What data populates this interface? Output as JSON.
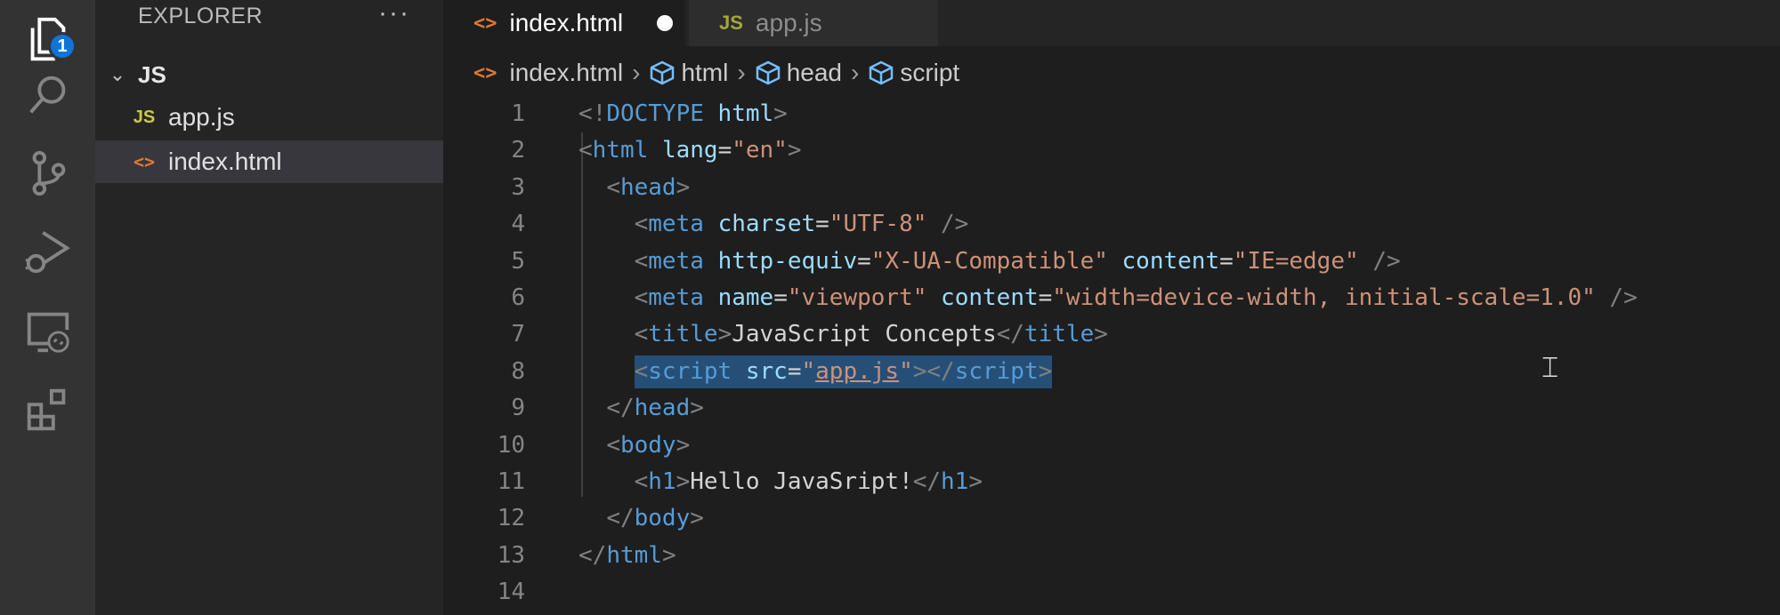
{
  "activity_bar": {
    "explorer_badge": "1",
    "icons": [
      "files-icon",
      "search-icon",
      "source-control-icon",
      "run-debug-icon",
      "remote-explorer-icon",
      "extensions-icon"
    ]
  },
  "sidebar": {
    "title": "EXPLORER",
    "more": "···",
    "folder": "JS",
    "files": [
      {
        "icon_text": "JS",
        "name": "app.js",
        "selected": false
      },
      {
        "icon_text": "<>",
        "name": "index.html",
        "selected": true
      }
    ]
  },
  "tabs": [
    {
      "icon_text": "<>",
      "label": "index.html",
      "active": true,
      "dirty": true
    },
    {
      "icon_text": "JS",
      "label": "app.js",
      "active": false,
      "dirty": false
    }
  ],
  "breadcrumb": {
    "file": "index.html",
    "items": [
      "html",
      "head",
      "script"
    ]
  },
  "code": {
    "lines": [
      {
        "n": "1",
        "tokens": [
          [
            "t",
            "<!"
          ],
          [
            "tg",
            "DOCTYPE"
          ],
          [
            "tx",
            " "
          ],
          [
            "at",
            "html"
          ],
          [
            "t",
            ">"
          ]
        ]
      },
      {
        "n": "2",
        "tokens": [
          [
            "t",
            "<"
          ],
          [
            "tg",
            "html"
          ],
          [
            "tx",
            " "
          ],
          [
            "at",
            "lang"
          ],
          [
            "tx",
            "="
          ],
          [
            "st",
            "\"en\""
          ],
          [
            "t",
            ">"
          ]
        ]
      },
      {
        "n": "3",
        "tokens": [
          [
            "tx",
            "  "
          ],
          [
            "t",
            "<"
          ],
          [
            "tg",
            "head"
          ],
          [
            "t",
            ">"
          ]
        ]
      },
      {
        "n": "4",
        "tokens": [
          [
            "tx",
            "    "
          ],
          [
            "t",
            "<"
          ],
          [
            "tg",
            "meta"
          ],
          [
            "tx",
            " "
          ],
          [
            "at",
            "charset"
          ],
          [
            "tx",
            "="
          ],
          [
            "st",
            "\"UTF-8\""
          ],
          [
            "tx",
            " "
          ],
          [
            "t",
            "/>"
          ]
        ]
      },
      {
        "n": "5",
        "tokens": [
          [
            "tx",
            "    "
          ],
          [
            "t",
            "<"
          ],
          [
            "tg",
            "meta"
          ],
          [
            "tx",
            " "
          ],
          [
            "at",
            "http-equiv"
          ],
          [
            "tx",
            "="
          ],
          [
            "st",
            "\"X-UA-Compatible\""
          ],
          [
            "tx",
            " "
          ],
          [
            "at",
            "content"
          ],
          [
            "tx",
            "="
          ],
          [
            "st",
            "\"IE=edge\""
          ],
          [
            "tx",
            " "
          ],
          [
            "t",
            "/>"
          ]
        ]
      },
      {
        "n": "6",
        "tokens": [
          [
            "tx",
            "    "
          ],
          [
            "t",
            "<"
          ],
          [
            "tg",
            "meta"
          ],
          [
            "tx",
            " "
          ],
          [
            "at",
            "name"
          ],
          [
            "tx",
            "="
          ],
          [
            "st",
            "\"viewport\""
          ],
          [
            "tx",
            " "
          ],
          [
            "at",
            "content"
          ],
          [
            "tx",
            "="
          ],
          [
            "st",
            "\"width=device-width, initial-scale=1.0\""
          ],
          [
            "tx",
            " "
          ],
          [
            "t",
            "/>"
          ]
        ]
      },
      {
        "n": "7",
        "tokens": [
          [
            "tx",
            "    "
          ],
          [
            "t",
            "<"
          ],
          [
            "tg",
            "title"
          ],
          [
            "t",
            ">"
          ],
          [
            "tx",
            "JavaScript Concepts"
          ],
          [
            "t",
            "</"
          ],
          [
            "tg",
            "title"
          ],
          [
            "t",
            ">"
          ]
        ]
      },
      {
        "n": "8",
        "tokens": [
          [
            "tx",
            "    "
          ],
          [
            "t",
            "<"
          ],
          [
            "tg",
            "script"
          ],
          [
            "tx",
            " "
          ],
          [
            "at",
            "src"
          ],
          [
            "tx",
            "="
          ],
          [
            "st",
            "\""
          ],
          [
            "stu",
            "app.js"
          ],
          [
            "st",
            "\""
          ],
          [
            "t",
            "></"
          ],
          [
            "tg",
            "script"
          ],
          [
            "t",
            ">"
          ]
        ],
        "selected": true
      },
      {
        "n": "9",
        "tokens": [
          [
            "tx",
            "  "
          ],
          [
            "t",
            "</"
          ],
          [
            "tg",
            "head"
          ],
          [
            "t",
            ">"
          ]
        ]
      },
      {
        "n": "10",
        "tokens": [
          [
            "tx",
            "  "
          ],
          [
            "t",
            "<"
          ],
          [
            "tg",
            "body"
          ],
          [
            "t",
            ">"
          ]
        ]
      },
      {
        "n": "11",
        "tokens": [
          [
            "tx",
            "    "
          ],
          [
            "t",
            "<"
          ],
          [
            "tg",
            "h1"
          ],
          [
            "t",
            ">"
          ],
          [
            "tx",
            "Hello JavaSript!"
          ],
          [
            "t",
            "</"
          ],
          [
            "tg",
            "h1"
          ],
          [
            "t",
            ">"
          ]
        ]
      },
      {
        "n": "12",
        "tokens": [
          [
            "tx",
            "  "
          ],
          [
            "t",
            "</"
          ],
          [
            "tg",
            "body"
          ],
          [
            "t",
            ">"
          ]
        ]
      },
      {
        "n": "13",
        "tokens": [
          [
            "t",
            "</"
          ],
          [
            "tg",
            "html"
          ],
          [
            "t",
            ">"
          ]
        ]
      },
      {
        "n": "14",
        "tokens": []
      }
    ]
  },
  "colors": {
    "tag": "#569cd6",
    "attribute": "#9cdcfe",
    "string": "#ce9178",
    "selection": "#264f78",
    "badge": "#0e74d8"
  }
}
